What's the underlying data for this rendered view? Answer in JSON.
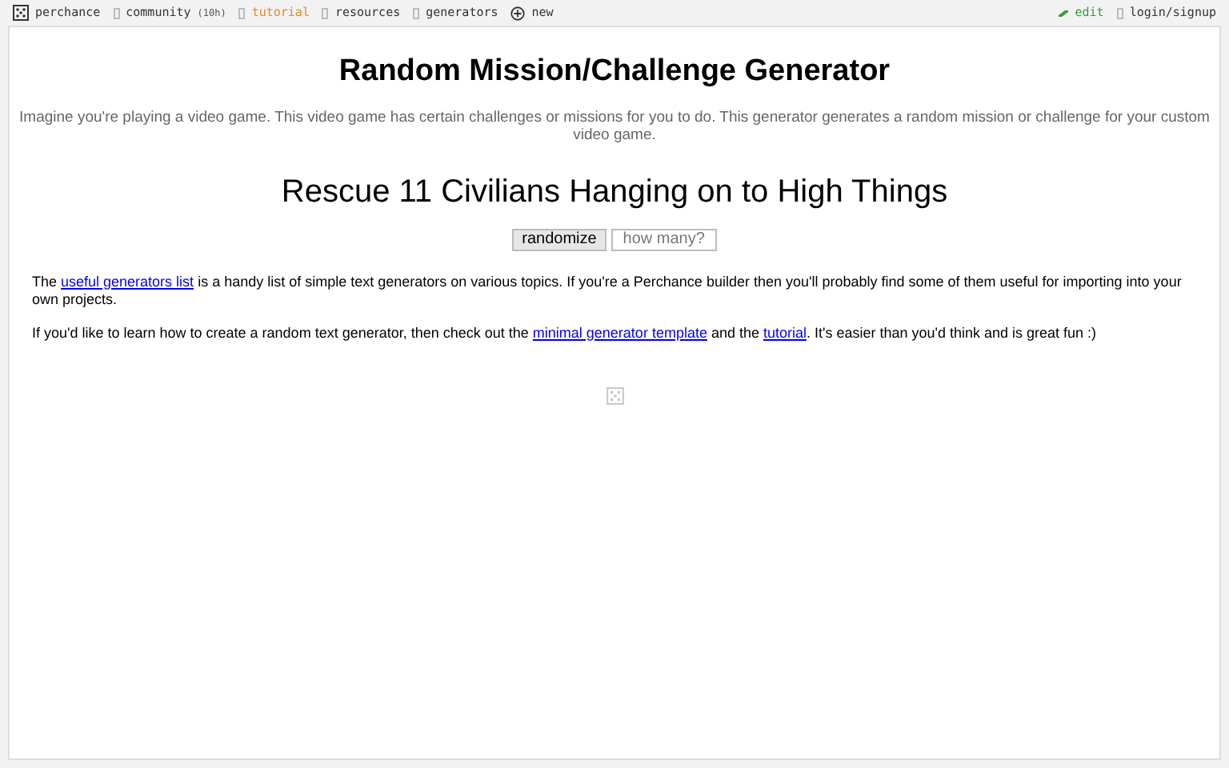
{
  "nav": {
    "left": [
      {
        "label": "perchance",
        "kind": "logo",
        "selected": false
      },
      {
        "label": "community",
        "kind": "link",
        "badge": "(10h)",
        "selected": false
      },
      {
        "label": "tutorial",
        "kind": "link",
        "selected": true
      },
      {
        "label": "resources",
        "kind": "link",
        "selected": false
      },
      {
        "label": "generators",
        "kind": "link",
        "selected": false
      },
      {
        "label": "new",
        "kind": "plus",
        "selected": false
      }
    ],
    "right": [
      {
        "label": "edit",
        "kind": "edit"
      },
      {
        "label": "login/signup",
        "kind": "link"
      }
    ]
  },
  "title": "Random Mission/Challenge Generator",
  "description": "Imagine you're playing a video game. This video game has certain challenges or missions for you to do. This generator generates a random mission or challenge for your custom video game.",
  "output": "Rescue 11 Civilians Hanging on to High Things",
  "randomize_button": "randomize",
  "count_field": {
    "placeholder": "how many?"
  },
  "paragraphs": [
    [
      {
        "kind": "text",
        "text": "The "
      },
      {
        "kind": "link",
        "text": "useful generators list"
      },
      {
        "kind": "text",
        "text": " is a handy list of simple text generators on various topics. If you're a Perchance builder then you'll probably find some of them useful for importing into your own projects."
      }
    ],
    [
      {
        "kind": "text",
        "text": "If you'd like to learn how to create a random text generator, then check out the "
      },
      {
        "kind": "link",
        "text": "minimal generator template"
      },
      {
        "kind": "text",
        "text": " and the "
      },
      {
        "kind": "link",
        "text": "tutorial"
      },
      {
        "kind": "text",
        "text": ". It's easier than you'd think and is great fun :)"
      }
    ]
  ]
}
